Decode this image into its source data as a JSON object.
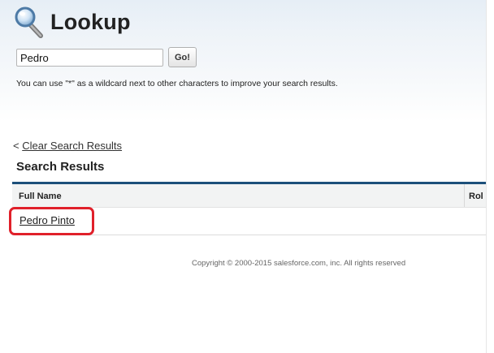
{
  "header": {
    "title": "Lookup",
    "icon": "magnifier-icon"
  },
  "search": {
    "value": "Pedro",
    "go_label": "Go!",
    "hint": "You can use \"*\" as a wildcard next to other characters to improve your search results."
  },
  "results": {
    "clear_prefix": "<",
    "clear_label": "Clear Search Results",
    "title": "Search Results",
    "columns": [
      "Full Name",
      "Rol"
    ],
    "rows": [
      {
        "full_name": "Pedro Pinto"
      }
    ]
  },
  "footer": {
    "copyright": "Copyright © 2000-2015 salesforce.com, inc. All rights reserved"
  },
  "colors": {
    "table_top_border": "#1c4f7a",
    "highlight": "#e0202a",
    "header_gradient_top": "#e6eef6"
  }
}
